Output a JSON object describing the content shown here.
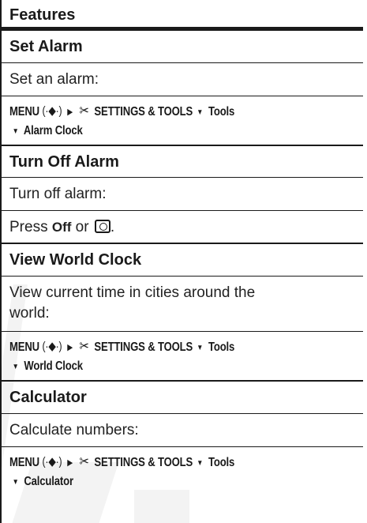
{
  "header": {
    "title": "Features"
  },
  "sections": [
    {
      "title": "Set Alarm",
      "description": "Set an alarm:",
      "path_line1": {
        "menu": "MENU",
        "settings": "SETTINGS & TOOLS",
        "tools": "Tools"
      },
      "path_line2": "Alarm Clock"
    },
    {
      "title": "Turn Off Alarm",
      "description": "Turn off alarm:",
      "press_prefix": "Press ",
      "press_key": "Off",
      "press_mid": " or ",
      "press_suffix": "."
    },
    {
      "title": "View World Clock",
      "description_line1": "View current time in cities around the",
      "description_line2": "world:",
      "path_line1": {
        "menu": "MENU",
        "settings": "SETTINGS & TOOLS",
        "tools": "Tools"
      },
      "path_line2": "World Clock"
    },
    {
      "title": "Calculator",
      "description": "Calculate numbers:",
      "path_line1": {
        "menu": "MENU",
        "settings": "SETTINGS & TOOLS",
        "tools": "Tools"
      },
      "path_line2": "Calculator"
    }
  ],
  "icons": {
    "nav_key": "(·◆·)",
    "arrow_right": "▶",
    "tools_icon": "✂",
    "arrow_down": "▼"
  }
}
